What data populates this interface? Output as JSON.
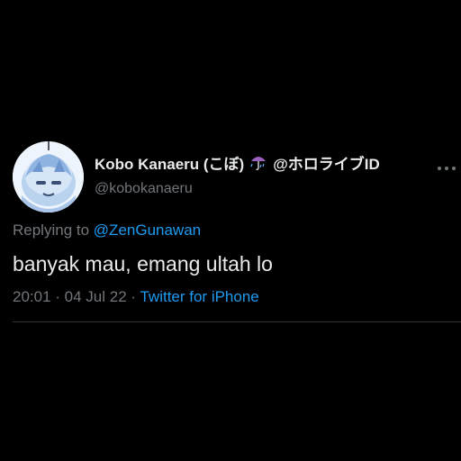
{
  "tweet": {
    "display_name": "Kobo Kanaeru (こぼ)",
    "emoji_icon": "umbrella-with-rain-icon",
    "name_suffix": "@ホロライブID",
    "handle": "@kobokanaeru",
    "replying_prefix": "Replying to",
    "replying_to": "@ZenGunawan",
    "text": "banyak mau, emang ultah lo",
    "time": "20:01",
    "sep1": " · ",
    "date": "04 Jul 22",
    "sep2": " · ",
    "source": "Twitter for iPhone"
  },
  "colors": {
    "background": "#000000",
    "primary_text": "#e7e9ea",
    "secondary_text": "#71767b",
    "link": "#1d9bf0",
    "divider": "#2f3336",
    "umbrella": "#9b5fc0"
  }
}
